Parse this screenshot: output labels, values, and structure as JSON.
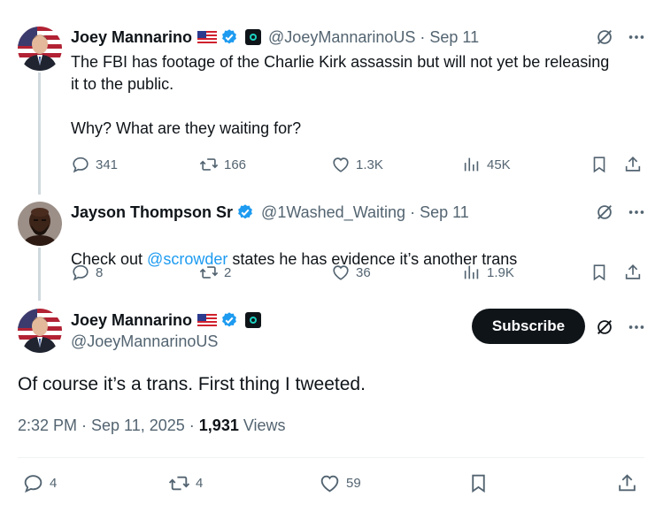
{
  "thread": {
    "tweet1": {
      "name": "Joey Mannarino",
      "handle": "@JoeyMannarinoUS",
      "dot": "·",
      "time": "Sep 11",
      "text": "The FBI has footage of the Charlie Kirk assassin but will not yet be releasing\nit to the public.\n\nWhy? What are they waiting for?",
      "replies": "341",
      "reposts": "166",
      "likes": "1.3K",
      "views": "45K"
    },
    "tweet2": {
      "name": "Jayson Thompson Sr",
      "handle": "@1Washed_Waiting",
      "dot": "·",
      "time": "Sep 11",
      "text_before": "Check out ",
      "mention": "@scrowder",
      "text_after": " states he has evidence it’s another trans",
      "replies": "8",
      "reposts": "2",
      "likes": "36",
      "views": "1.9K"
    }
  },
  "main_tweet": {
    "name": "Joey Mannarino",
    "handle": "@JoeyMannarinoUS",
    "subscribe_label": "Subscribe",
    "text": "Of course it’s a trans. First thing I tweeted.",
    "timestamp": "2:32 PM · Sep 11, 2025 · ",
    "view_count": "1,931",
    "views_label": " Views",
    "replies": "4",
    "reposts": "4",
    "likes": "59"
  },
  "colors": {
    "accent": "#1d9bf0",
    "secondary_text": "#536471",
    "primary_text": "#0f1419",
    "thread_line": "#cfd9de"
  },
  "icons": [
    "us-flag-icon",
    "verified-badge-icon",
    "affiliate-badge-icon",
    "grok-icon",
    "more-icon",
    "reply-icon",
    "repost-icon",
    "like-icon",
    "views-icon",
    "bookmark-icon",
    "share-icon"
  ]
}
